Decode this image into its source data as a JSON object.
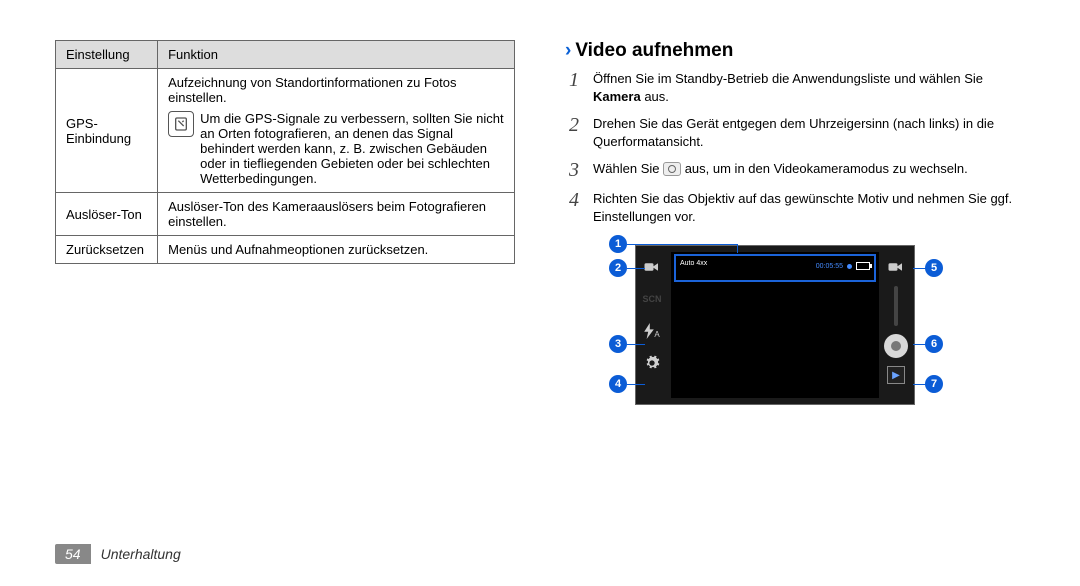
{
  "table": {
    "headers": [
      "Einstellung",
      "Funktion"
    ],
    "rows": [
      {
        "setting": "GPS-Einbindung",
        "func_main": "Aufzeichnung von Standortinformationen zu Fotos einstellen.",
        "tip": "Um die GPS-Signale zu verbessern, sollten Sie nicht an Orten fotografieren, an denen das Signal behindert werden kann, z. B. zwischen Gebäuden oder in tiefliegenden Gebieten oder bei schlechten Wetterbedingungen."
      },
      {
        "setting": "Auslöser-Ton",
        "func_main": "Auslöser-Ton des Kameraauslösers beim Fotografieren einstellen."
      },
      {
        "setting": "Zurücksetzen",
        "func_main": "Menüs und Aufnahmeoptionen zurücksetzen."
      }
    ]
  },
  "section": {
    "title": "Video aufnehmen",
    "steps": [
      {
        "num": "1",
        "pre": "Öffnen Sie im Standby-Betrieb die Anwendungsliste und wählen Sie ",
        "bold": "Kamera",
        "post": " aus."
      },
      {
        "num": "2",
        "text": "Drehen Sie das Gerät entgegen dem Uhrzeigersinn (nach links) in die Querformatansicht."
      },
      {
        "num": "3",
        "pre": "Wählen Sie ",
        "icon": true,
        "post": " aus, um in den Videokameramodus zu wechseln."
      },
      {
        "num": "4",
        "text": "Richten Sie das Objektiv auf das gewünschte Motiv und nehmen Sie ggf. Einstellungen vor."
      }
    ]
  },
  "diagram": {
    "callouts": [
      "1",
      "2",
      "3",
      "4",
      "5",
      "6",
      "7"
    ],
    "status_left": "Auto\n4xx",
    "timecode": "00:05:55",
    "scn_label": "SCN",
    "flash_label": "A"
  },
  "footer": {
    "page": "54",
    "chapter": "Unterhaltung"
  }
}
